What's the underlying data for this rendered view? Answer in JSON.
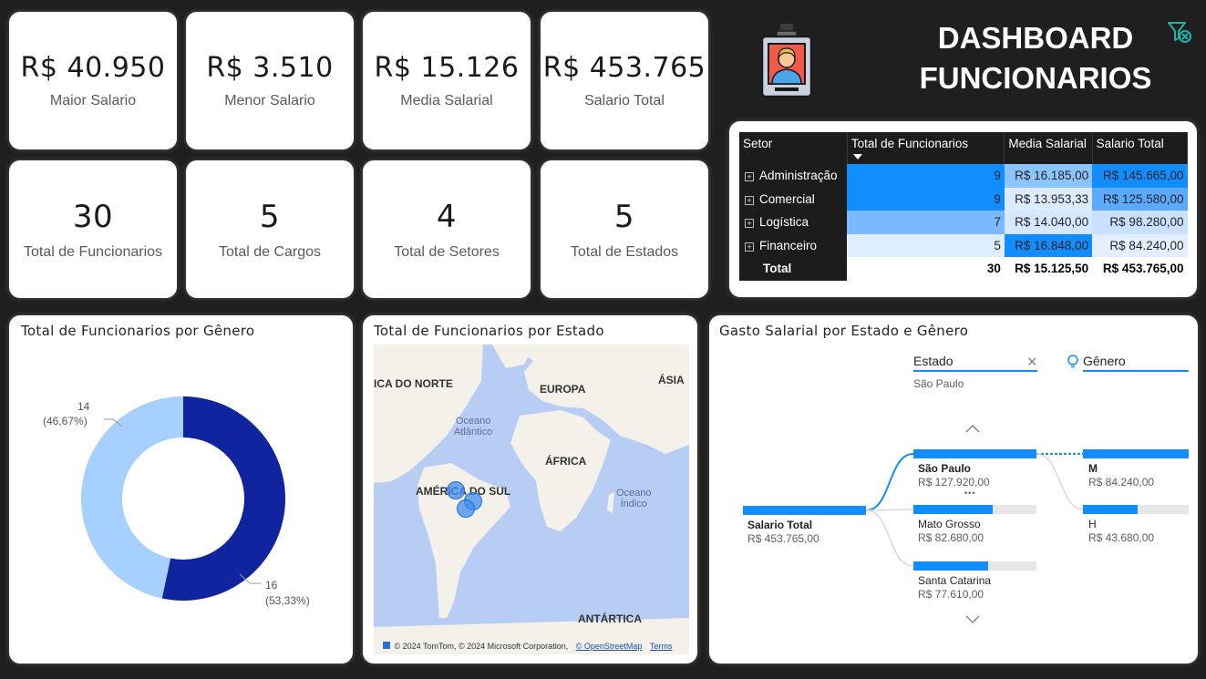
{
  "kpis": [
    {
      "value": "R$ 40.950",
      "label": "Maior Salario"
    },
    {
      "value": "R$ 3.510",
      "label": "Menor Salario"
    },
    {
      "value": "R$ 15.126",
      "label": "Media Salarial"
    },
    {
      "value": "R$ 453.765",
      "label": "Salario Total"
    },
    {
      "value": "30",
      "label": "Total de Funcionarios"
    },
    {
      "value": "5",
      "label": "Total de Cargos"
    },
    {
      "value": "4",
      "label": "Total de Setores"
    },
    {
      "value": "5",
      "label": "Total de Estados"
    }
  ],
  "header": {
    "title_line1": "DASHBOARD",
    "title_line2": "FUNCIONARIOS",
    "badge_icon": "employee-badge-icon",
    "filter_icon": "clear-filter-icon"
  },
  "colors": {
    "accent": "#118dff",
    "donut_dark": "#1024a0",
    "donut_light": "#a6d0ff",
    "map_water": "#b8cdf4"
  },
  "matrix": {
    "columns": [
      "Setor",
      "Total de Funcionarios",
      "Media Salarial",
      "Salario Total"
    ],
    "rows": [
      {
        "setor": "Administração",
        "total": "9",
        "media": "R$ 16.185,00",
        "salario": "R$ 145.665,00"
      },
      {
        "setor": "Comercial",
        "total": "9",
        "media": "R$ 13.953,33",
        "salario": "R$ 125.580,00"
      },
      {
        "setor": "Logística",
        "total": "7",
        "media": "R$ 14.040,00",
        "salario": "R$ 98.280,00"
      },
      {
        "setor": "Financeiro",
        "total": "5",
        "media": "R$ 16.848,00",
        "salario": "R$ 84.240,00"
      }
    ],
    "total_row": {
      "label": "Total",
      "total": "30",
      "media": "R$ 15.125,50",
      "salario": "R$ 453.765,00"
    }
  },
  "gender_chart": {
    "title": "Total de Funcionarios por Gênero",
    "slices": [
      {
        "value": 16,
        "label": "16",
        "pct": "(53,33%)",
        "color": "#1024a0"
      },
      {
        "value": 14,
        "label": "14",
        "pct": "(46,67%)",
        "color": "#a6d0ff"
      }
    ]
  },
  "chart_data": {
    "type": "pie",
    "title": "Total de Funcionarios por Gênero",
    "categories": [
      "16",
      "14"
    ],
    "values": [
      16,
      14
    ],
    "percent_labels": [
      "53,33%",
      "46,67%"
    ]
  },
  "map": {
    "title": "Total de Funcionarios por Estado",
    "labels": {
      "na": "ICA DO NORTE",
      "eu": "EUROPA",
      "asia": "ÁSIA",
      "af": "ÁFRICA",
      "sa": "AMÉRICA DO SUL",
      "ant": "ANTÁRTICA"
    },
    "oceans": {
      "atl_1": "Oceano",
      "atl_2": "Atlântico",
      "ind_1": "Oceano",
      "ind_2": "Índico"
    },
    "attribution": "© 2024 TomTom, © 2024 Microsoft Corporation,",
    "osm_link": "© OpenStreetMap",
    "terms_link": "Terms"
  },
  "decomp": {
    "title": "Gasto Salarial por Estado e Gênero",
    "col1_header": "Estado",
    "col1_filter": "São Paulo",
    "col2_header": "Gênero",
    "root": {
      "label": "Salario Total",
      "value": "R$ 453.765,00"
    },
    "estados": [
      {
        "label": "São Paulo",
        "value": "R$ 127.920,00",
        "fraction": 1.0
      },
      {
        "label": "Mato Grosso",
        "value": "R$ 82.680,00",
        "fraction": 0.646
      },
      {
        "label": "Santa Catarina",
        "value": "R$ 77.610,00",
        "fraction": 0.607
      }
    ],
    "generos": [
      {
        "label": "M",
        "value": "R$ 84.240,00",
        "fraction": 1.0
      },
      {
        "label": "H",
        "value": "R$ 43.680,00",
        "fraction": 0.519
      }
    ],
    "more": "•••"
  }
}
